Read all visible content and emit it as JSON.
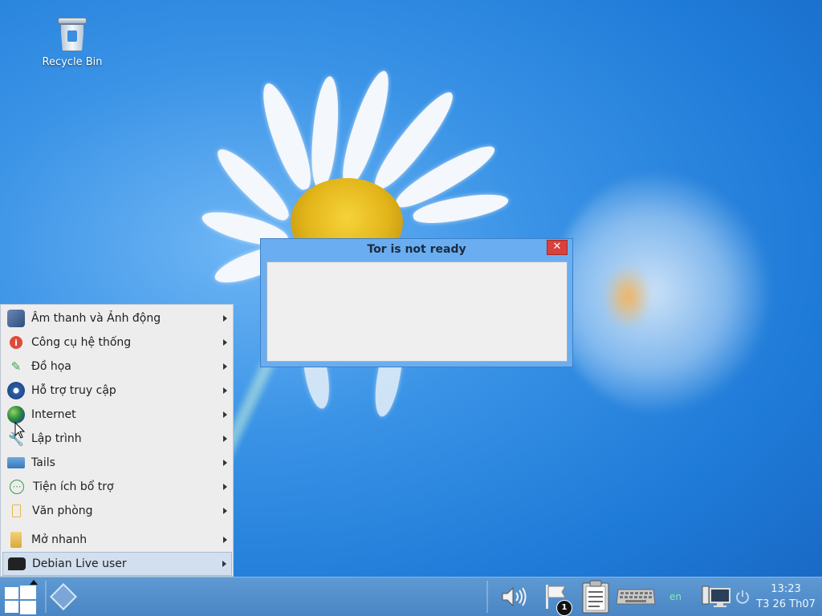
{
  "desktop": {
    "icons": [
      {
        "label": "Recycle Bin",
        "icon": "recycle-bin-icon"
      }
    ]
  },
  "dialog": {
    "title": "Tor is not ready",
    "close_label": "✕",
    "close_color": "#d9413c"
  },
  "start_menu": {
    "items": [
      {
        "label": "Âm thanh và Ảnh động",
        "icon": "multimedia-icon",
        "glyph": "🎞"
      },
      {
        "label": "Công cụ hệ thống",
        "icon": "system-tools-icon",
        "glyph": "i"
      },
      {
        "label": "Đồ họa",
        "icon": "graphics-icon",
        "glyph": "✎"
      },
      {
        "label": "Hỗ trợ truy cập",
        "icon": "accessibility-icon",
        "glyph": "✦"
      },
      {
        "label": "Internet",
        "icon": "globe-icon",
        "glyph": ""
      },
      {
        "label": "Lập trình",
        "icon": "programming-icon",
        "glyph": "🔧"
      },
      {
        "label": "Tails",
        "icon": "tails-icon",
        "glyph": ""
      },
      {
        "label": "Tiện ích bổ trợ",
        "icon": "accessories-icon",
        "glyph": "⋯"
      },
      {
        "label": "Văn phòng",
        "icon": "office-icon",
        "glyph": ""
      },
      {
        "label": "Mở nhanh",
        "icon": "folder-icon",
        "glyph": ""
      },
      {
        "label": "Debian Live user",
        "icon": "user-chat-icon",
        "glyph": ""
      }
    ]
  },
  "taskbar": {
    "language": "en",
    "notification_count": "1",
    "time": "13:23",
    "date": "T3 26 Th07"
  }
}
